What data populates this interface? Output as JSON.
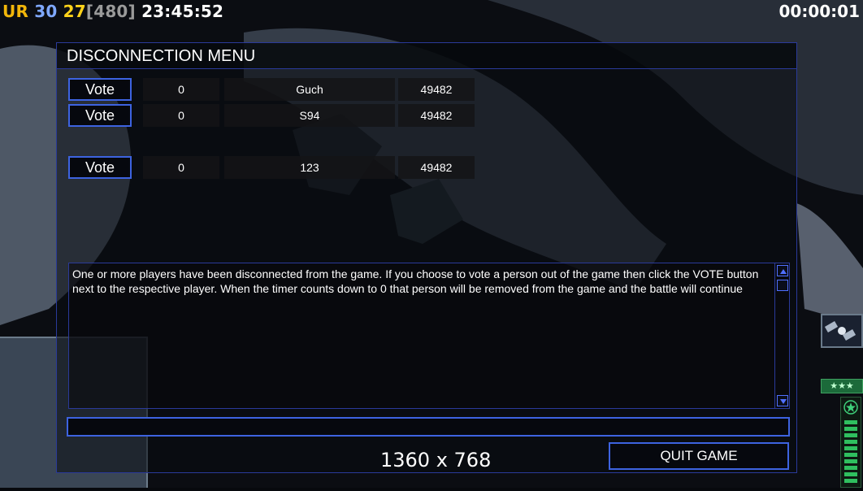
{
  "hud": {
    "ur_label": "UR",
    "val_a": "30",
    "val_b": "27",
    "bracket": "[480]",
    "clock": "23:45:52",
    "timer": "00:00:01"
  },
  "dialog": {
    "title": "DISCONNECTION MENU",
    "players": [
      {
        "vote_label": "Vote",
        "votes": "0",
        "name": "Guch",
        "ping": "49482"
      },
      {
        "vote_label": "Vote",
        "votes": "0",
        "name": "S94",
        "ping": "49482"
      },
      {
        "vote_label": "Vote",
        "votes": "0",
        "name": "123",
        "ping": "49482"
      }
    ],
    "message": "One or more players have been disconnected from the game. If you choose to vote a person out of the game then click the VOTE button next to the respective player. When the timer counts down to 0 that person will be removed from the game and the battle will continue",
    "chat_input_value": "",
    "quit_label": "QUIT GAME"
  },
  "resolution_text": "1360 x 768",
  "side_hud": {
    "stars": "★★★"
  },
  "colors": {
    "accent_border": "#3d63e0",
    "ur_color": "#f2b60a",
    "val_a_color": "#7fa8ff",
    "val_b_color": "#ffd21a",
    "bracket_color": "#9a9a9a"
  }
}
